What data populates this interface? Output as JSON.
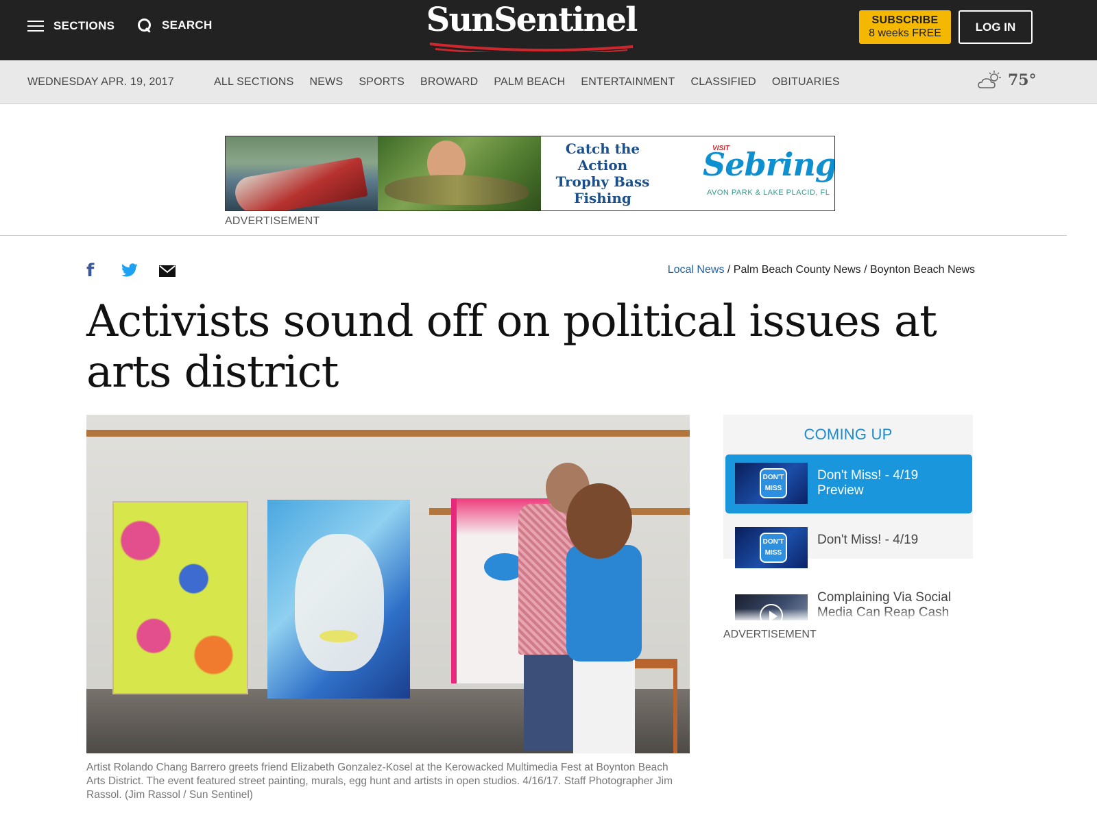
{
  "header": {
    "sections_label": "SECTIONS",
    "search_label": "SEARCH",
    "logo_text": "SunSentinel",
    "subscribe_line1": "SUBSCRIBE",
    "subscribe_line2": "8 weeks FREE",
    "login_label": "LOG IN"
  },
  "nav": {
    "date": "WEDNESDAY APR. 19, 2017",
    "items": [
      "ALL SECTIONS",
      "NEWS",
      "SPORTS",
      "BROWARD",
      "PALM BEACH",
      "ENTERTAINMENT",
      "CLASSIFIED",
      "OBITUARIES"
    ],
    "temperature": "75°",
    "weather_icon": "partly-cloudy-icon"
  },
  "ad": {
    "copy_line1": "Catch the",
    "copy_line2": "Action",
    "copy_line3": "Trophy Bass",
    "copy_line4": "Fishing",
    "brand_visit": "VISIT",
    "brand_name": "Sebring",
    "brand_sub": "AVON PARK & LAKE PLACID, FL",
    "label": "ADVERTISEMENT"
  },
  "breadcrumb": {
    "items": [
      "Local News",
      "Palm Beach County News",
      "Boynton Beach News"
    ],
    "separator": "/"
  },
  "share": {
    "facebook": "f"
  },
  "article": {
    "headline": "Activists sound off on political issues at arts district",
    "caption": "Artist Rolando Chang Barrero greets friend Elizabeth Gonzalez-Kosel at the Kerowacked Multimedia Fest at Boynton Beach Arts District. The event featured street painting, murals, egg hunt and artists in open studios. 4/16/17. Staff Photographer Jim Rassol. (Jim Rassol / Sun Sentinel)"
  },
  "coming_up": {
    "title": "COMING UP",
    "items": [
      {
        "label": "Don't Miss! - 4/19 Preview",
        "badge": "DON'T MISS"
      },
      {
        "label": "Don't Miss! - 4/19",
        "badge": "DON'T MISS"
      },
      {
        "label": "Complaining Via Social Media Can Reap Cash"
      }
    ],
    "ad_label": "ADVERTISEMENT"
  },
  "colors": {
    "header_bg": "#222222",
    "subscribe_bg": "#f5b800",
    "link_blue": "#1e5fa8",
    "widget_accent": "#1a97dc"
  }
}
